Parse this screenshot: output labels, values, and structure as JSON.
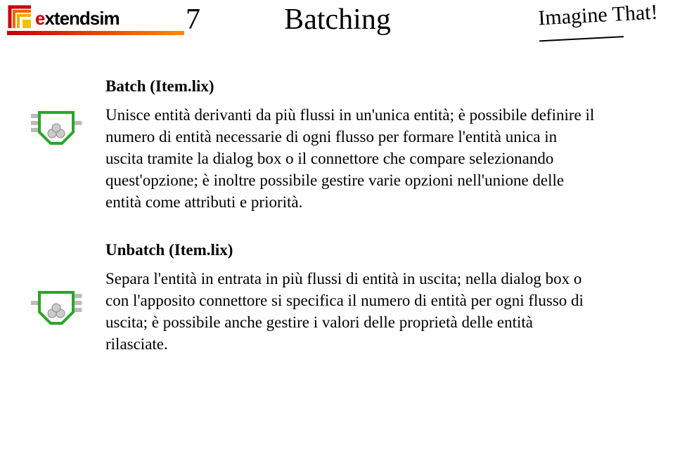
{
  "header": {
    "logo_text": "extendsim",
    "page_number": "7",
    "title": "Batching",
    "brand_tag": "Imagine That!"
  },
  "sections": [
    {
      "title": "Batch (Item.lix)",
      "body": "Unisce entità derivanti da più flussi in un'unica entità; è possibile definire il numero di entità necessarie di ogni flusso per formare l'entità unica in uscita tramite la dialog box o il connettore che compare selezionando quest'opzione; è inoltre possibile gestire varie opzioni nell'unione delle entità come attributi e priorità."
    },
    {
      "title": "Unbatch (Item.lix)",
      "body": "Separa l'entità in entrata in più flussi di entità in uscita; nella dialog box o con l'apposito connettore si specifica il numero di entità per ogni flusso di uscita; è possibile anche gestire i valori delle proprietà delle entità rilasciate."
    }
  ]
}
